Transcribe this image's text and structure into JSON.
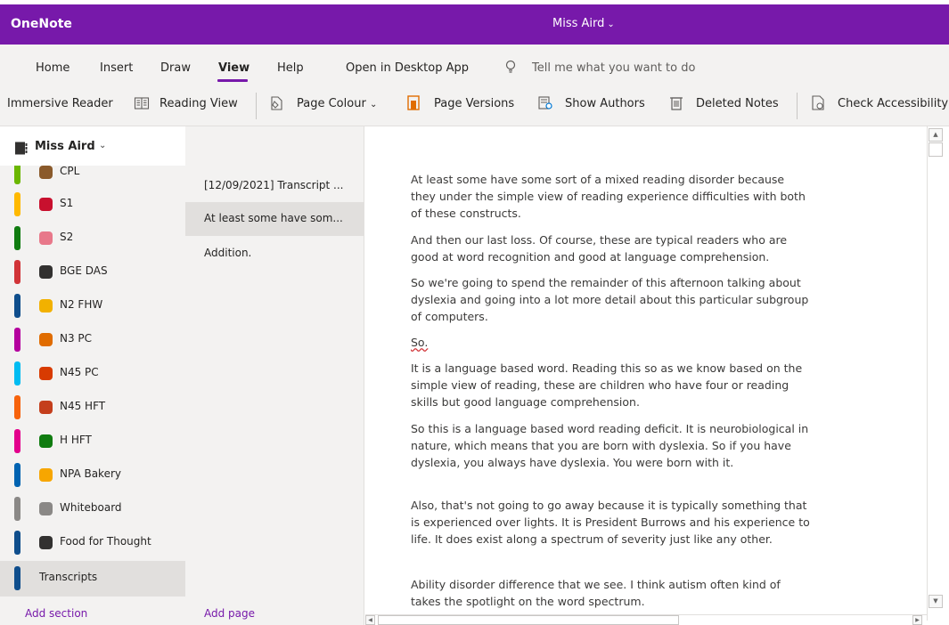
{
  "app": {
    "name": "OneNote",
    "notebook_title": "Miss Aird",
    "title_chevron": "⌄"
  },
  "menu": {
    "tabs": [
      "Home",
      "Insert",
      "Draw",
      "View",
      "Help"
    ],
    "active_tab": "View",
    "open_desktop": "Open in Desktop App",
    "tell_me": "Tell me what you want to do"
  },
  "ribbon": {
    "immersive_reader": "Immersive Reader",
    "reading_view": "Reading View",
    "page_colour": "Page Colour",
    "page_colour_chevron": "⌄",
    "page_versions": "Page Versions",
    "show_authors": "Show Authors",
    "deleted_notes": "Deleted Notes",
    "check_accessibility": "Check Accessibility"
  },
  "notebook": {
    "name": "Miss Aird",
    "chevron": "⌄"
  },
  "sections": [
    {
      "label": "CPL",
      "tab_color": "#6bb700",
      "icon_color": "#8a5a2b"
    },
    {
      "label": "S1",
      "tab_color": "#ffb900",
      "icon_color": "#c8102e"
    },
    {
      "label": "S2",
      "tab_color": "#107c10",
      "icon_color": "#e8788a"
    },
    {
      "label": "BGE DAS",
      "tab_color": "#d13438",
      "icon_color": "#323130"
    },
    {
      "label": "N2 FHW",
      "tab_color": "#0f4e8c",
      "icon_color": "#f2b100"
    },
    {
      "label": "N3 PC",
      "tab_color": "#b4009e",
      "icon_color": "#e06c00"
    },
    {
      "label": "N45 PC",
      "tab_color": "#00bcf2",
      "icon_color": "#d83b01"
    },
    {
      "label": "N45 HFT",
      "tab_color": "#f7630c",
      "icon_color": "#c43e1c"
    },
    {
      "label": "H HFT",
      "tab_color": "#e3008c",
      "icon_color": "#107c10"
    },
    {
      "label": "NPA Bakery",
      "tab_color": "#0063b1",
      "icon_color": "#f7a600"
    },
    {
      "label": "Whiteboard",
      "tab_color": "#8a8886",
      "icon_color": "#8a8886"
    },
    {
      "label": "Food for Thought",
      "tab_color": "#0f4e8c",
      "icon_color": "#323130"
    },
    {
      "label": "Transcripts",
      "tab_color": "#0f4e8c",
      "icon_color": ""
    }
  ],
  "active_section": "Transcripts",
  "pages": [
    {
      "label": "[12/09/2021] Transcript ..."
    },
    {
      "label": "At least some have som..."
    },
    {
      "label": "Addition."
    }
  ],
  "active_page": "At least some have som...",
  "footer": {
    "add_section": "Add section",
    "add_page": "Add page"
  },
  "content": {
    "paragraphs": [
      "At least some have some sort of a mixed reading disorder because they under the simple view of reading experience difficulties with both of these constructs.",
      "And then our last loss. Of course, these are typical readers who are good at word recognition and good at language comprehension.",
      "So we're going to spend the remainder of this afternoon talking about dyslexia and going into a lot more detail about this particular subgroup of computers.",
      "So.",
      "It is a language based word. Reading this so as we know based on the simple view of reading, these are children who have four or reading skills but good language comprehension.",
      "So this is a language based word reading deficit. It is neurobiological in nature, which means that you are born with dyslexia. So if you have dyslexia, you always have dyslexia. You were born with it.",
      "Also, that's not going to go away because it is typically something that is experienced over lights. It is President Burrows and his experience to life. It does exist along a spectrum of severity just like any other.",
      "Ability disorder difference that we see. I think autism often kind of takes the spotlight on the word spectrum."
    ]
  },
  "colors": {
    "brand": "#7719aa",
    "panel": "#f3f2f1",
    "selected": "#e1dfdd"
  }
}
